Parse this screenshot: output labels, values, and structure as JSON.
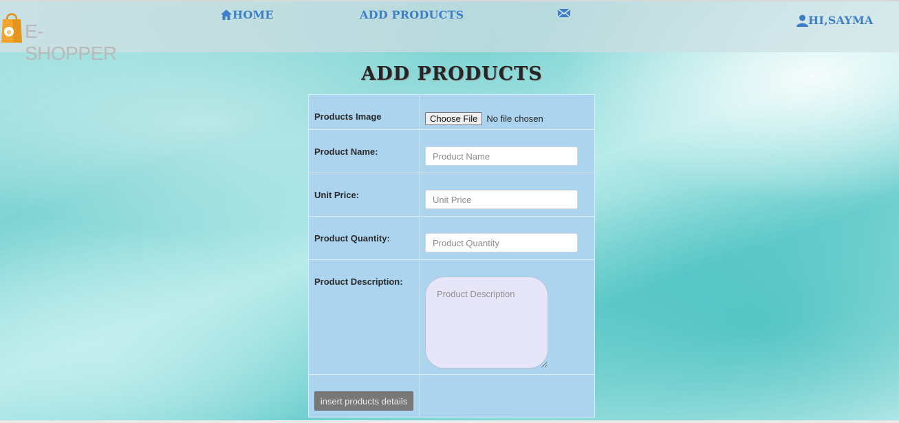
{
  "brand": {
    "logo_text": "E-SHOPPER",
    "logo_letter": "e"
  },
  "nav": {
    "home_label": "HOME",
    "add_products_label": "ADD PRODUCTS",
    "user_label": "HI,SAYMA"
  },
  "page": {
    "title": "ADD PRODUCTS"
  },
  "form": {
    "image": {
      "label": "Products Image",
      "button_label": "Choose File",
      "status": "No file chosen"
    },
    "name": {
      "label": "Product Name:",
      "placeholder": "Product Name",
      "value": ""
    },
    "price": {
      "label": "Unit Price:",
      "placeholder": "Unit Price",
      "value": ""
    },
    "quantity": {
      "label": "Product Quantity:",
      "placeholder": "Product Quantity",
      "value": ""
    },
    "description": {
      "label": "Product Description:",
      "placeholder": "Product Description",
      "value": ""
    },
    "submit_label": "insert products details"
  },
  "icons": {
    "home": "home-icon",
    "mail": "envelope-icon",
    "user": "user-icon",
    "logo": "shopping-bag-icon"
  },
  "colors": {
    "nav_link": "#3d7fc7",
    "form_bg": "#acd4ef",
    "logo_accent": "#f3a42a",
    "submit_bg": "#787878"
  }
}
